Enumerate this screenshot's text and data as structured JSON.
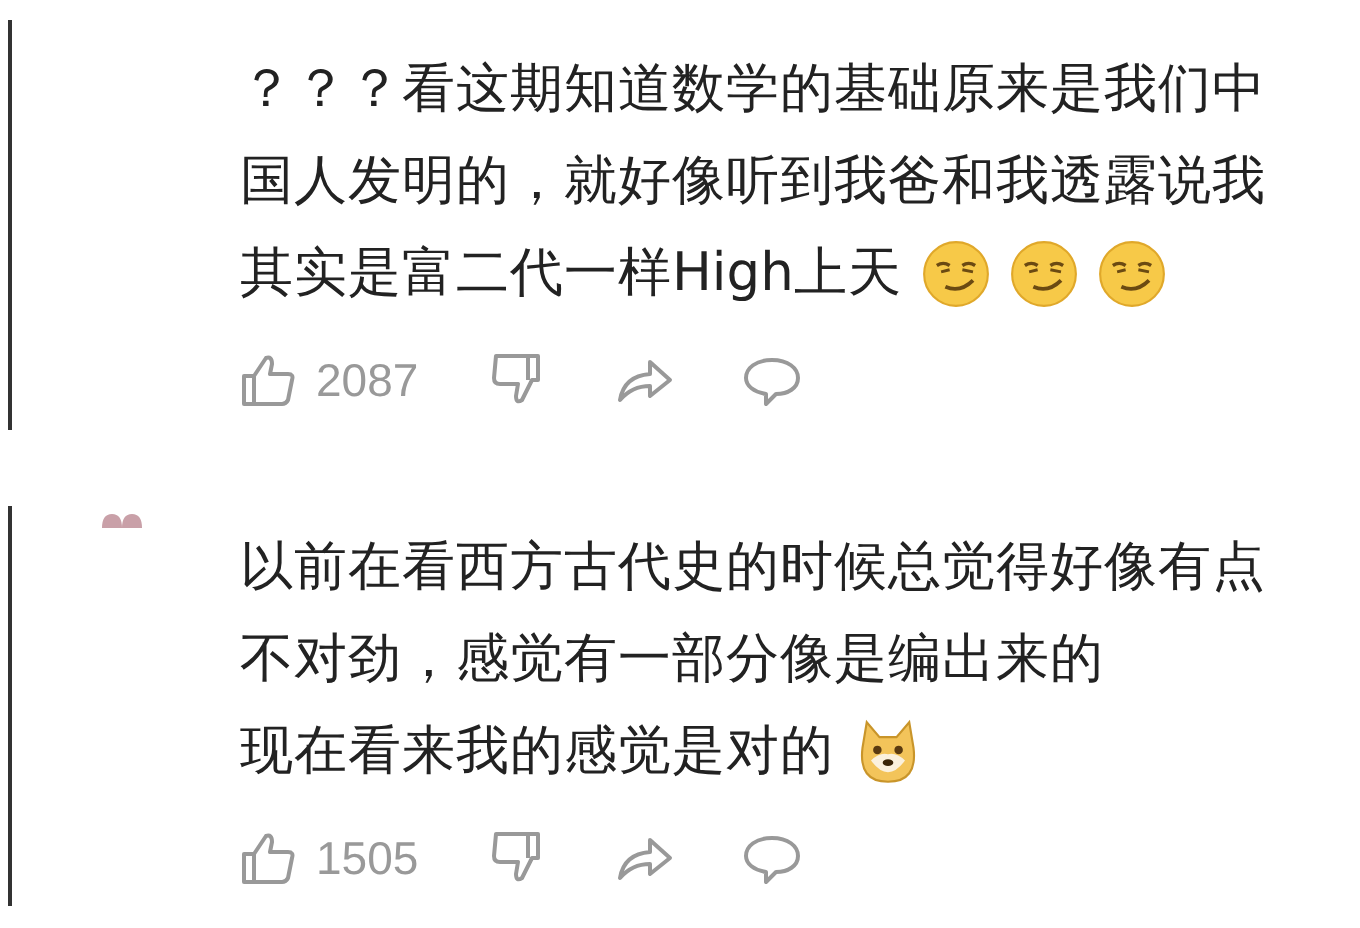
{
  "comments": [
    {
      "show_avatar": false,
      "lines": [
        "？？？看这期知道数学的基础原来是我们中",
        "国人发明的，就好像听到我爸和我透露说我",
        "其实是富二代一样High上天"
      ],
      "emojis": [
        {
          "kind": "smirk"
        },
        {
          "kind": "smirk"
        },
        {
          "kind": "smirk"
        }
      ],
      "likes": "2087"
    },
    {
      "show_avatar": true,
      "lines": [
        "以前在看西方古代史的时候总觉得好像有点",
        "不对劲，感觉有一部分像是编出来的",
        "现在看来我的感觉是对的"
      ],
      "emojis": [
        {
          "kind": "doge"
        }
      ],
      "likes": "1505"
    }
  ]
}
